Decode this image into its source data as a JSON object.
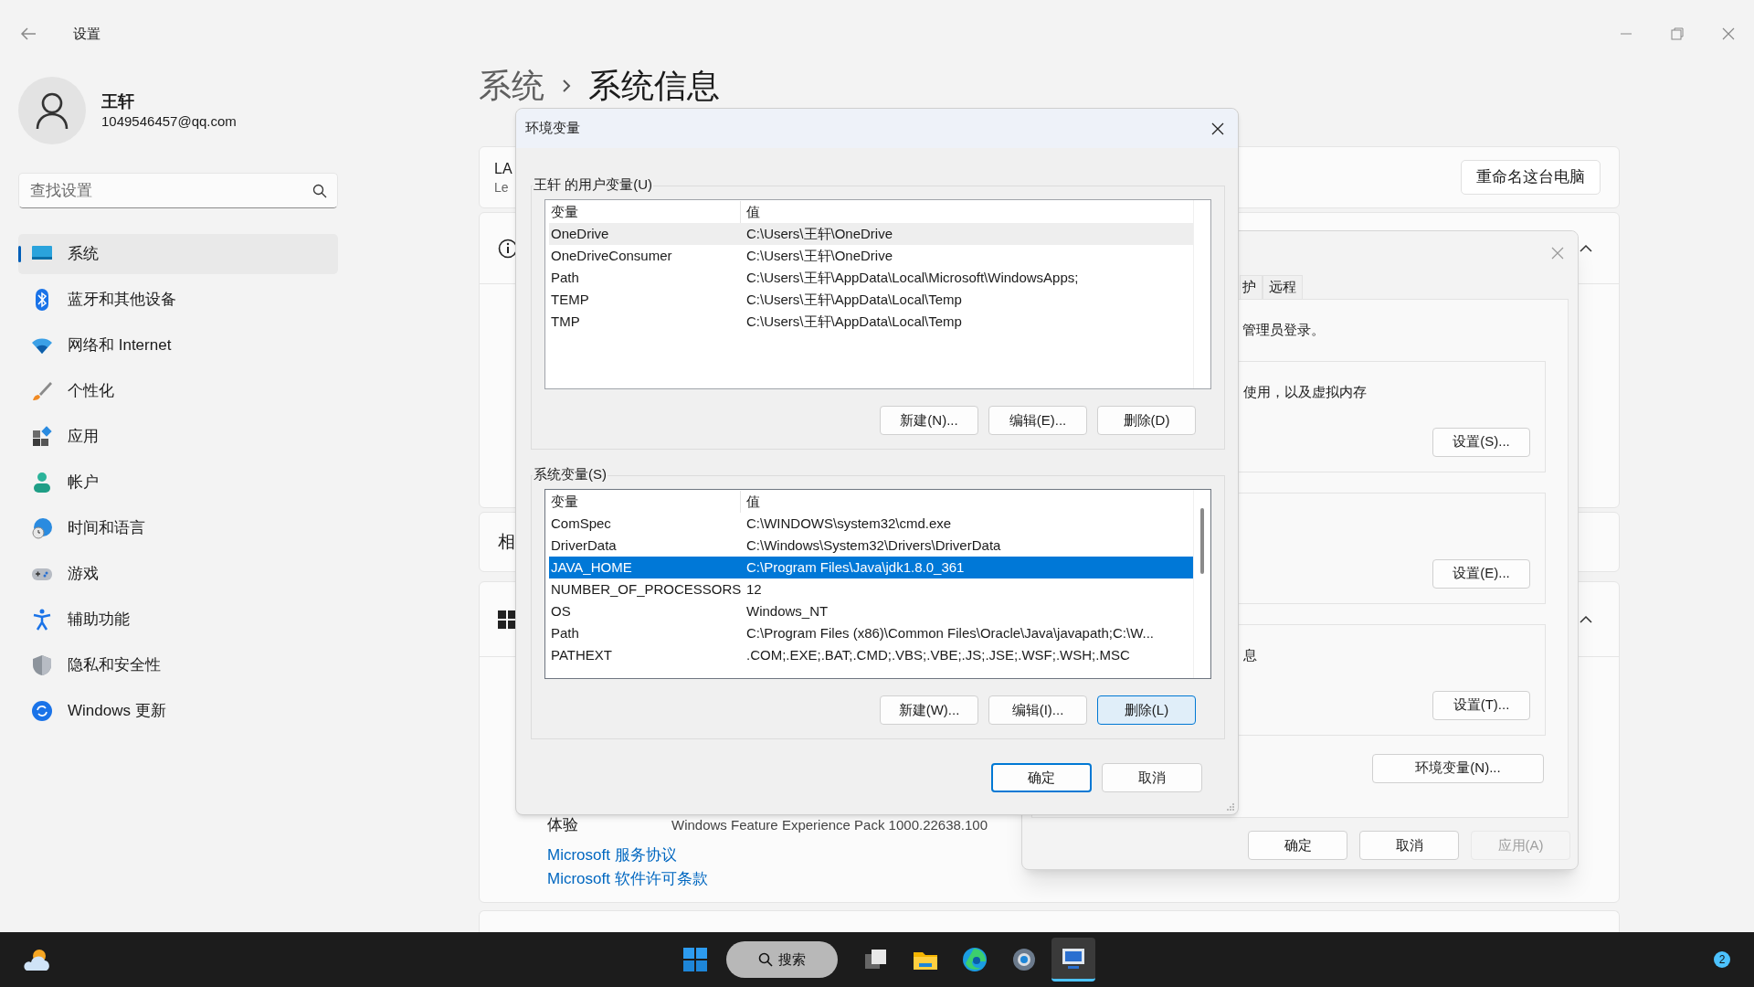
{
  "settings": {
    "title": "设置",
    "user": {
      "name": "王轩",
      "email": "1049546457@qq.com"
    },
    "search": {
      "placeholder": "查找设置"
    },
    "nav": [
      {
        "label": "系统",
        "kind": "system",
        "selected": true
      },
      {
        "label": "蓝牙和其他设备",
        "kind": "bluetooth",
        "selected": false
      },
      {
        "label": "网络和 Internet",
        "kind": "network",
        "selected": false
      },
      {
        "label": "个性化",
        "kind": "brush",
        "selected": false
      },
      {
        "label": "应用",
        "kind": "apps",
        "selected": false
      },
      {
        "label": "帐户",
        "kind": "account",
        "selected": false
      },
      {
        "label": "时间和语言",
        "kind": "time",
        "selected": false
      },
      {
        "label": "游戏",
        "kind": "gaming",
        "selected": false
      },
      {
        "label": "辅助功能",
        "kind": "accessibility",
        "selected": false
      },
      {
        "label": "隐私和安全性",
        "kind": "privacy",
        "selected": false
      },
      {
        "label": "Windows 更新",
        "kind": "update",
        "selected": false
      }
    ],
    "breadcrumb": [
      "系统",
      "系统信息"
    ],
    "device_card": {
      "name": "LA",
      "model": "Le",
      "rename_button": "重命名这台电脑"
    },
    "related_label": "相",
    "spec": {
      "label": "体验",
      "value": "Windows Feature Experience Pack 1000.22638.100"
    },
    "links": [
      "Microsoft 服务协议",
      "Microsoft 软件许可条款"
    ]
  },
  "system_properties": {
    "tabs": [
      {
        "label": "护",
        "selected": false
      },
      {
        "label": "远程",
        "selected": false
      }
    ],
    "admin_note": "管理员登录。",
    "groups": [
      {
        "text": "使用，以及虚拟内存",
        "button": "设置(S)..."
      },
      {
        "button": "设置(E)..."
      },
      {
        "text": "息",
        "button": "设置(T)..."
      }
    ],
    "env_button": "环境变量(N)...",
    "buttons": [
      {
        "label": "确定",
        "disabled": false
      },
      {
        "label": "取消",
        "disabled": false
      },
      {
        "label": "应用(A)",
        "disabled": true
      }
    ]
  },
  "env_dialog": {
    "title": "环境变量",
    "user_vars": {
      "legend": "王轩 的用户变量(U)",
      "columns": [
        "变量",
        "值"
      ],
      "focused": false,
      "rows": [
        {
          "name": "OneDrive",
          "value": "C:\\Users\\王轩\\OneDrive",
          "selected": true
        },
        {
          "name": "OneDriveConsumer",
          "value": "C:\\Users\\王轩\\OneDrive",
          "selected": false
        },
        {
          "name": "Path",
          "value": "C:\\Users\\王轩\\AppData\\Local\\Microsoft\\WindowsApps;",
          "selected": false
        },
        {
          "name": "TEMP",
          "value": "C:\\Users\\王轩\\AppData\\Local\\Temp",
          "selected": false
        },
        {
          "name": "TMP",
          "value": "C:\\Users\\王轩\\AppData\\Local\\Temp",
          "selected": false
        }
      ],
      "buttons": [
        {
          "label": "新建(N)...",
          "focused": false
        },
        {
          "label": "编辑(E)...",
          "focused": false
        },
        {
          "label": "删除(D)",
          "focused": false
        }
      ]
    },
    "system_vars": {
      "legend": "系统变量(S)",
      "columns": [
        "变量",
        "值"
      ],
      "focused": true,
      "rows": [
        {
          "name": "ComSpec",
          "value": "C:\\WINDOWS\\system32\\cmd.exe",
          "selected": false
        },
        {
          "name": "DriverData",
          "value": "C:\\Windows\\System32\\Drivers\\DriverData",
          "selected": false
        },
        {
          "name": "JAVA_HOME",
          "value": "C:\\Program Files\\Java\\jdk1.8.0_361",
          "selected": true
        },
        {
          "name": "NUMBER_OF_PROCESSORS",
          "value": "12",
          "selected": false
        },
        {
          "name": "OS",
          "value": "Windows_NT",
          "selected": false
        },
        {
          "name": "Path",
          "value": "C:\\Program Files (x86)\\Common Files\\Oracle\\Java\\javapath;C:\\W...",
          "selected": false
        },
        {
          "name": "PATHEXT",
          "value": ".COM;.EXE;.BAT;.CMD;.VBS;.VBE;.JS;.JSE;.WSF;.WSH;.MSC",
          "selected": false
        }
      ],
      "buttons": [
        {
          "label": "新建(W)...",
          "focused": false
        },
        {
          "label": "编辑(I)...",
          "focused": false
        },
        {
          "label": "删除(L)",
          "focused": true
        }
      ]
    },
    "buttons": [
      {
        "label": "确定",
        "default": true
      },
      {
        "label": "取消",
        "default": false
      }
    ]
  },
  "taskbar": {
    "search": "搜索",
    "badge": "2",
    "apps": [
      {
        "kind": "start",
        "active": false
      },
      {
        "kind": "taskview",
        "active": false
      },
      {
        "kind": "explorer",
        "active": false
      },
      {
        "kind": "edge",
        "active": false
      },
      {
        "kind": "settings",
        "active": false
      },
      {
        "kind": "sysprop",
        "active": true
      }
    ]
  }
}
